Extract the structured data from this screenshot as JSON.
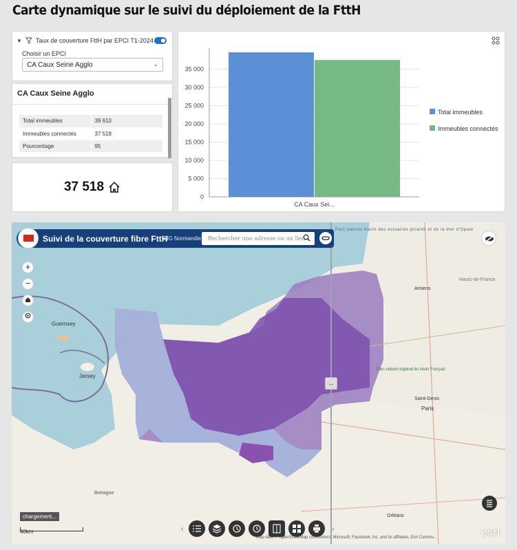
{
  "page_title": "Carte dynamique sur le suivi du déploiement de la FttH",
  "filter": {
    "label": "Taux de couverture FttH par EPCI T1-2024",
    "enabled": true,
    "choose_label": "Choisir un EPCI",
    "selected": "CA Caux Seine Agglo"
  },
  "details": {
    "title": "CA Caux Seine Agglo",
    "rows": [
      {
        "label": "Total immeubles",
        "value": "39 610"
      },
      {
        "label": "Immeubles connectés",
        "value": "37 518"
      },
      {
        "label": "Pourcentage",
        "value": "95"
      }
    ]
  },
  "count": {
    "value": "37 518",
    "icon": "home-icon"
  },
  "colors": {
    "accent": "#1e73c8",
    "header": "#173f7a",
    "total": "#5b8fd6",
    "connected": "#77b985"
  },
  "chart_data": {
    "type": "bar",
    "categories": [
      "CA Caux Sei..."
    ],
    "series": [
      {
        "name": "Total immeubles",
        "values": [
          39610
        ],
        "color": "#5b8fd6"
      },
      {
        "name": "Immeubles connectés",
        "values": [
          37518
        ],
        "color": "#77b985"
      }
    ],
    "ylim": [
      0,
      40000
    ],
    "yticks": [
      0,
      5000,
      10000,
      15000,
      20000,
      25000,
      30000,
      35000
    ],
    "ytick_labels": [
      "0",
      "5 000",
      "10 000",
      "15 000",
      "20 000",
      "25 000",
      "30 000",
      "35 000"
    ],
    "grid": true,
    "legend": "right"
  },
  "map": {
    "app_title": "Suivi de la couverture fibre FttH",
    "app_subtitle": "SIG Normandie",
    "search_placeholder": "Rechercher une adresse ou un lieu",
    "loading": "chargement...",
    "scale": "40km",
    "attribution": "Map data © OpenStreetMap contributors, Microsoft, Facebook, Inc. and its affiliates, Esri Commu...",
    "esri": "esri",
    "labels": {
      "guernsey": "Guernsey",
      "jersey": "Jersey",
      "bretagne": "Bretagne",
      "paris": "Paris",
      "amiens": "Amiens",
      "hauts_de_france": "Hauts-de-France",
      "orleans": "Orléans",
      "saint_denis": "Saint-Denis",
      "vexin": "Parc naturel régional du Vexin Français",
      "somme": "Parc naturel marin des estuaires picards et de la mer d'Opale"
    }
  }
}
